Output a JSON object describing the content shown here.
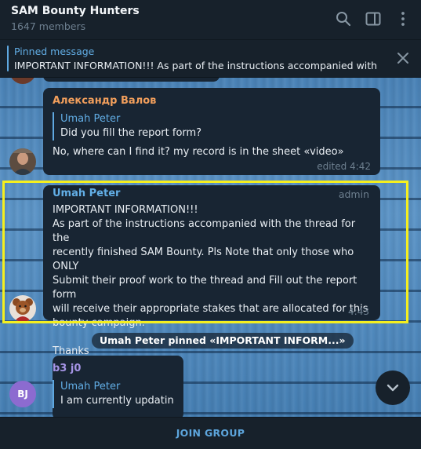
{
  "header": {
    "title": "SAM Bounty Hunters",
    "members": "1647 members",
    "icons": [
      "search-icon",
      "sidebar-toggle-icon",
      "more-vertical-icon"
    ]
  },
  "pinned": {
    "title": "Pinned message",
    "text": "IMPORTANT INFORMATION!!! As part of the instructions accompanied with ...",
    "close_icon": "close-icon"
  },
  "messages": [
    {
      "sender": "Александр Валов",
      "reply_name": "Umah Peter",
      "reply_text": "Did you fill the report form?",
      "text": "No, where can I find it? my record is in the sheet «video»",
      "meta": "edited 4:42"
    },
    {
      "sender": "Umah Peter",
      "badge": "admin",
      "lines": [
        "IMPORTANT INFORMATION!!!",
        "As part of the instructions accompanied with the thread for the",
        "recently finished SAM Bounty. Pls Note that only those who ONLY",
        "Submit their proof work to the thread and Fill out the report form",
        "will receive their appropriate stakes that are allocated for this",
        "bounty campaign.",
        "",
        "Thanks"
      ],
      "time": "4:43"
    },
    {
      "sender": "b3 j0",
      "avatar_initials": "BJ",
      "reply_name": "Umah Peter",
      "reply_text": "I am currently updatin..."
    }
  ],
  "service_message": "Umah Peter pinned «IMPORTANT INFORM...»",
  "footer": {
    "join_label": "JOIN GROUP"
  },
  "colors": {
    "sender_alexander": "#f29f5c",
    "sender_umah": "#62aee6",
    "sender_b3j0": "#a695e7",
    "avatar_bj": "#8c6bd0",
    "highlight": "#f5ef1f",
    "accent": "#5da5dc"
  }
}
